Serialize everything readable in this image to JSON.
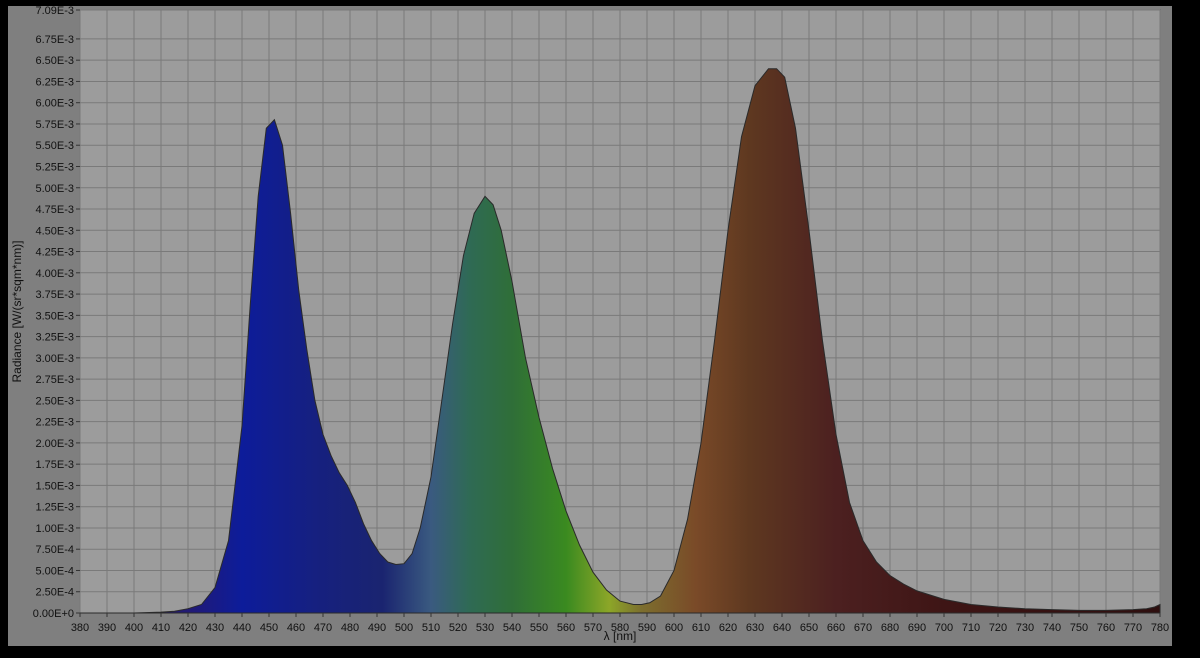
{
  "chart_data": {
    "type": "area",
    "title": "",
    "xlabel": "λ [nm]",
    "ylabel": "Radiance [W/(sr*sqm*nm)]",
    "xlim": [
      380,
      780
    ],
    "ylim": [
      0,
      0.00709
    ],
    "grid": true,
    "legend": "none",
    "x_ticks": [
      380,
      390,
      400,
      410,
      420,
      430,
      440,
      450,
      460,
      470,
      480,
      490,
      500,
      510,
      520,
      530,
      540,
      550,
      560,
      570,
      580,
      590,
      600,
      610,
      620,
      630,
      640,
      650,
      660,
      670,
      680,
      690,
      700,
      710,
      720,
      730,
      740,
      750,
      760,
      770,
      780
    ],
    "x_tick_labels": [
      "380",
      "390",
      "400",
      "410",
      "420",
      "430",
      "440",
      "450",
      "460",
      "470",
      "480",
      "490",
      "500",
      "510",
      "520",
      "530",
      "540",
      "550",
      "560",
      "570",
      "580",
      "590",
      "600",
      "610",
      "620",
      "630",
      "640",
      "650",
      "660",
      "670",
      "680",
      "690",
      "700",
      "710",
      "720",
      "730",
      "740",
      "750",
      "760",
      "770",
      "780"
    ],
    "y_ticks": [
      0,
      0.00025,
      0.0005,
      0.00075,
      0.001,
      0.00125,
      0.0015,
      0.00175,
      0.002,
      0.00225,
      0.0025,
      0.00275,
      0.003,
      0.00325,
      0.0035,
      0.00375,
      0.004,
      0.00425,
      0.0045,
      0.00475,
      0.005,
      0.00525,
      0.0055,
      0.00575,
      0.006,
      0.00625,
      0.0065,
      0.00675,
      0.00709
    ],
    "y_tick_labels": [
      "0.00E+0",
      "2.50E-4",
      "5.00E-4",
      "7.50E-4",
      "1.00E-3",
      "1.25E-3",
      "1.50E-3",
      "1.75E-3",
      "2.00E-3",
      "2.25E-3",
      "2.50E-3",
      "2.75E-3",
      "3.00E-3",
      "3.25E-3",
      "3.50E-3",
      "3.75E-3",
      "4.00E-3",
      "4.25E-3",
      "4.50E-3",
      "4.75E-3",
      "5.00E-3",
      "5.25E-3",
      "5.50E-3",
      "5.75E-3",
      "6.00E-3",
      "6.25E-3",
      "6.50E-3",
      "6.75E-3",
      "7.09E-3"
    ],
    "series": [
      {
        "x": [
          380,
          390,
          400,
          410,
          415,
          420,
          425,
          430,
          435,
          440,
          443,
          446,
          449,
          452,
          455,
          458,
          461,
          464,
          467,
          470,
          473,
          476,
          479,
          482,
          485,
          488,
          491,
          494,
          497,
          500,
          503,
          506,
          510,
          514,
          518,
          522,
          526,
          530,
          533,
          536,
          540,
          545,
          550,
          555,
          560,
          565,
          570,
          575,
          580,
          585,
          588,
          591,
          595,
          600,
          605,
          610,
          615,
          620,
          625,
          630,
          635,
          638,
          641,
          645,
          650,
          655,
          660,
          665,
          670,
          675,
          680,
          685,
          690,
          700,
          710,
          720,
          730,
          740,
          750,
          760,
          770,
          775,
          778,
          780
        ],
        "y": [
          0.0,
          0.0,
          0.0,
          1e-05,
          2e-05,
          5e-05,
          0.0001,
          0.0003,
          0.00085,
          0.0022,
          0.0036,
          0.0049,
          0.0057,
          0.0058,
          0.0055,
          0.0047,
          0.0038,
          0.0031,
          0.0025,
          0.0021,
          0.00185,
          0.00165,
          0.0015,
          0.0013,
          0.00105,
          0.00085,
          0.0007,
          0.0006,
          0.00057,
          0.00058,
          0.0007,
          0.001,
          0.0016,
          0.0025,
          0.0034,
          0.0042,
          0.0047,
          0.0049,
          0.0048,
          0.0045,
          0.0039,
          0.003,
          0.0023,
          0.0017,
          0.0012,
          0.0008,
          0.00048,
          0.00027,
          0.00014,
          0.0001,
          0.0001,
          0.00012,
          0.0002,
          0.0005,
          0.0011,
          0.002,
          0.0032,
          0.0045,
          0.0056,
          0.0062,
          0.0064,
          0.0064,
          0.0063,
          0.0057,
          0.0045,
          0.0032,
          0.0021,
          0.0013,
          0.00085,
          0.0006,
          0.00044,
          0.00034,
          0.00026,
          0.00016,
          0.0001,
          7e-05,
          5e-05,
          4e-05,
          3e-05,
          3e-05,
          4e-05,
          5e-05,
          7e-05,
          0.0001
        ]
      }
    ]
  },
  "colors": {
    "frame": "#7f7f7f",
    "plot_background": "#9c9c9c",
    "grid": "#7a7a7a",
    "curve_stroke": "#2a2a2a"
  }
}
